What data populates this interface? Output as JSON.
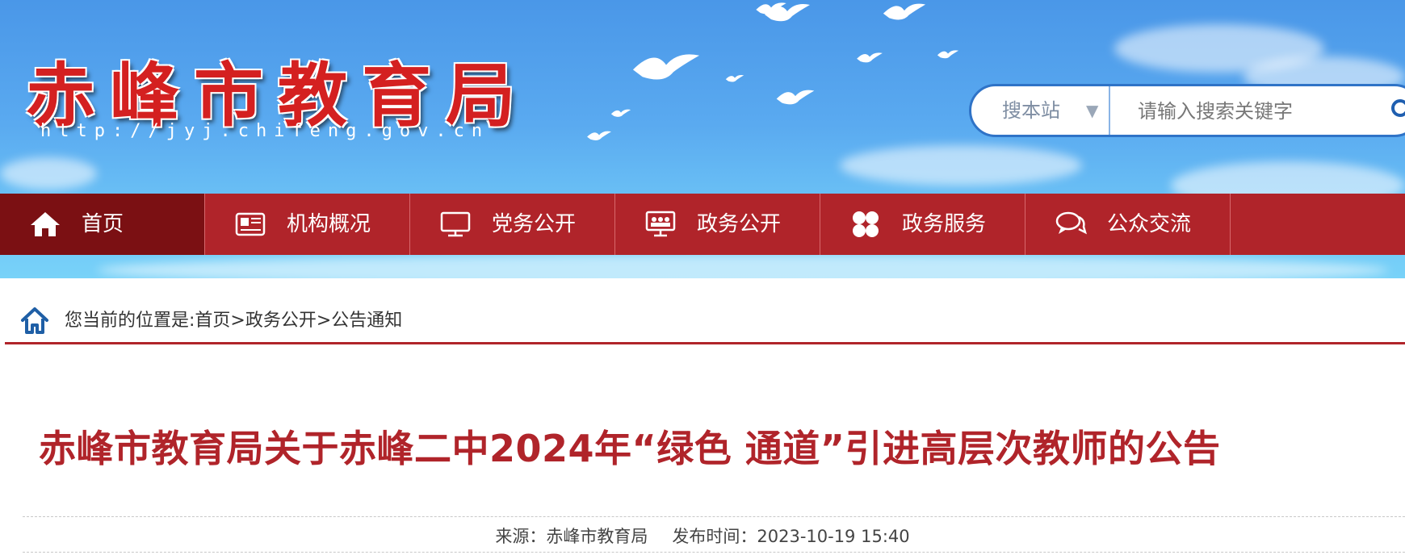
{
  "header": {
    "site_title": "赤峰市教育局",
    "site_url": "http://jyj.chifeng.gov.cn"
  },
  "search": {
    "scope_label": "搜本站",
    "scope_arrow": "▼",
    "placeholder": "请输入搜索关键字",
    "icon": "search-icon"
  },
  "nav": {
    "items": [
      {
        "label": "首页",
        "icon": "home-icon"
      },
      {
        "label": "机构概况",
        "icon": "newspaper-icon"
      },
      {
        "label": "党务公开",
        "icon": "monitor-icon"
      },
      {
        "label": "政务公开",
        "icon": "group-screen-icon"
      },
      {
        "label": "政务服务",
        "icon": "grid-icon"
      },
      {
        "label": "公众交流",
        "icon": "chat-icon"
      }
    ]
  },
  "breadcrumb": {
    "text": "您当前的位置是:首页>政务公开>公告通知"
  },
  "article": {
    "title": "赤峰市教育局关于赤峰二中2024年“绿色 通道”引进高层次教师的公告",
    "source": "来源：赤峰市教育局",
    "published": "发布时间：2023-10-19 15:40"
  },
  "colors": {
    "brand_red": "#b0242a",
    "nav_active": "#7b1013",
    "sky_blue": "#5aaaf0"
  }
}
